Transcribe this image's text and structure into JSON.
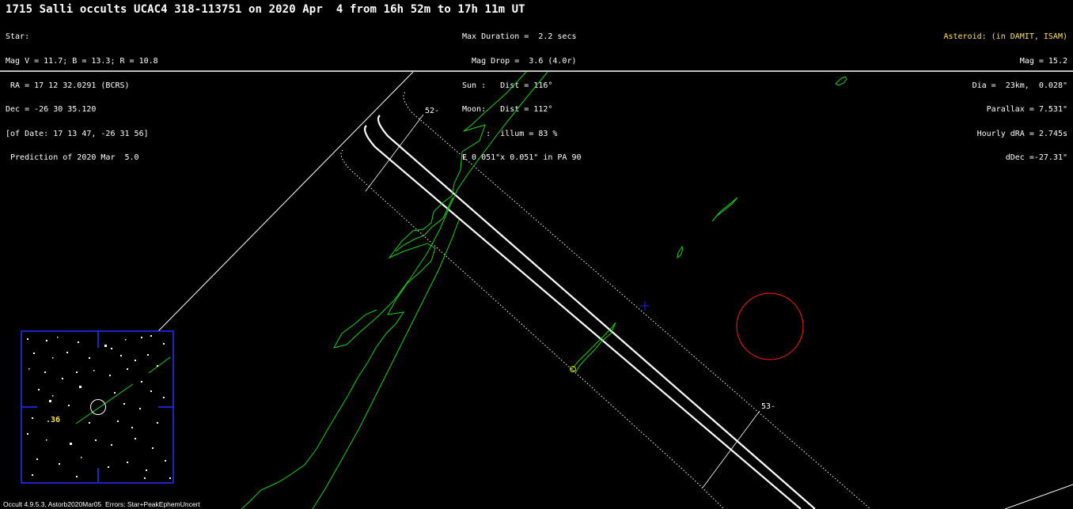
{
  "header": {
    "title": "1715 Salli occults UCAC4 318-113751 on 2020 Apr  4 from 16h 52m to 17h 11m UT"
  },
  "star_info": {
    "lines": [
      "Star:",
      "Mag V = 11.7; B = 13.3; R = 10.8",
      " RA = 17 12 32.0291 (BCRS)",
      "Dec = -26 30 35.120",
      "[of Date: 17 13 47, -26 31 56]",
      " Prediction of 2020 Mar  5.0"
    ]
  },
  "event_info": {
    "lines": [
      "Max Duration =  2.2 secs",
      "  Mag Drop =  3.6 (4.0r)",
      "Sun :   Dist = 116°",
      "Moon:   Dist = 112°",
      "     :  illum = 83 %",
      "E 0.051\"x 0.051\" in PA 90"
    ]
  },
  "asteroid_info": {
    "heading": "Asteroid: (in DAMIT, ISAM)",
    "lines": [
      "Mag = 15.2",
      "Dia =  23km,  0.028\"",
      "Parallax = 7.531\"",
      "Hourly dRA = 2.745s",
      "dDec =-27.31\""
    ]
  },
  "map": {
    "time_labels": [
      "52-",
      "53-"
    ],
    "colors": {
      "path": "#ffffff",
      "coastline": "#19d019",
      "moon_circle": "#ff1a1a",
      "center_cross": "#2020ff",
      "inset_frame": "#2030ff",
      "site_marker": "#e0c020"
    }
  },
  "inset": {
    "label": ".36"
  },
  "footer": {
    "text": "Occult 4.9.5.3, Astorb2020Mar05  Errors: Star+PeakEphemUncert"
  }
}
